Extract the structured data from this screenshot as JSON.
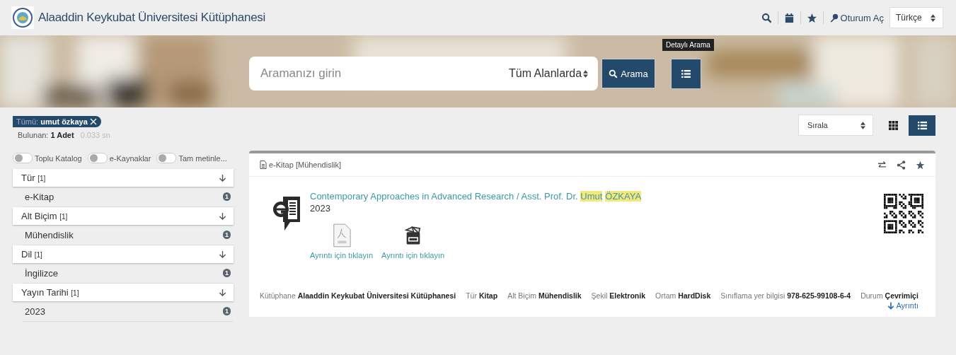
{
  "header": {
    "title": "Alaaddin Keykubat Üniversitesi Kütüphanesi",
    "tools": [
      {
        "kind": "search"
      },
      {
        "kind": "calendar"
      },
      {
        "kind": "star"
      }
    ],
    "login": "Oturum Aç",
    "language": "Türkçe"
  },
  "search": {
    "placeholder": "Aramanızı girin",
    "scope": "Tüm Alanlarda",
    "button": "Arama",
    "tooltip": "Detaylı Arama"
  },
  "filter_tag": {
    "label": "Tümü:",
    "value": "umut özkaya"
  },
  "results": {
    "label": "Bulunan:",
    "count": "1 Adet",
    "time": "0.033 sn"
  },
  "toggles": [
    {
      "label": "Toplu Katalog",
      "on": false
    },
    {
      "label": "e-Kaynaklar",
      "on": false
    },
    {
      "label": "Tam metinle...",
      "on": false
    }
  ],
  "facets": [
    {
      "title": "Tür",
      "count": "[1]",
      "items": [
        {
          "label": "e-Kitap",
          "count": "1"
        }
      ]
    },
    {
      "title": "Alt Biçim",
      "count": "[1]",
      "items": [
        {
          "label": "Mühendislik",
          "count": "1"
        }
      ]
    },
    {
      "title": "Dil",
      "count": "[1]",
      "items": [
        {
          "label": "İngilizce",
          "count": "1"
        }
      ]
    },
    {
      "title": "Yayın Tarihi",
      "count": "[1]",
      "items": [
        {
          "label": "2023",
          "count": "1"
        }
      ]
    }
  ],
  "sort": {
    "label": "Sırala"
  },
  "view_modes": [
    {
      "kind": "grid",
      "selected": false
    },
    {
      "kind": "list",
      "selected": true
    }
  ],
  "record": {
    "type_label": "e-Kitap [Mühendislik]",
    "title_parts": [
      {
        "text": "Contemporary Approaches in Advanced Research / Asst. Prof. Dr. ",
        "highlighted": false
      },
      {
        "text": "Umut",
        "highlighted": true
      },
      {
        "text": "ÖZKAYA",
        "highlighted": true
      }
    ],
    "year": "2023",
    "files": [
      {
        "kind": "pdf",
        "label": "Ayrıntı için tıklayın"
      },
      {
        "kind": "pdf-image",
        "label": "Ayrıntı için tıklayın"
      }
    ],
    "details": [
      {
        "label": "Kütüphane",
        "value": "Alaaddin Keykubat Üniversitesi Kütüphanesi"
      },
      {
        "label": "Tür",
        "value": "Kitap"
      },
      {
        "label": "Alt Biçim",
        "value": "Mühendislik"
      },
      {
        "label": "Şekil",
        "value": "Elektronik"
      },
      {
        "label": "Ortam",
        "value": "HardDisk"
      },
      {
        "label": "Sınıflama yer bilgisi",
        "value": "978-625-99108-6-4"
      },
      {
        "label": "Durum",
        "value": "Çevrimiçi"
      }
    ],
    "more_link": "Ayrıntı"
  }
}
